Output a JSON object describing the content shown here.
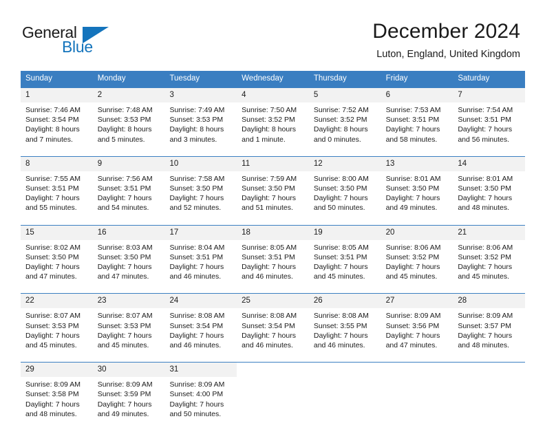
{
  "brand": {
    "name_top": "General",
    "name_bottom": "Blue",
    "accent_color": "#1474bc",
    "triangle_icon": "triangle-icon"
  },
  "header": {
    "title": "December 2024",
    "subtitle": "Luton, England, United Kingdom"
  },
  "calendar": {
    "header_bg": "#3a7ec1",
    "daynum_bg": "#f2f2f2",
    "weekdays": [
      "Sunday",
      "Monday",
      "Tuesday",
      "Wednesday",
      "Thursday",
      "Friday",
      "Saturday"
    ],
    "weeks": [
      [
        {
          "day": "1",
          "sunrise": "Sunrise: 7:46 AM",
          "sunset": "Sunset: 3:54 PM",
          "daylight1": "Daylight: 8 hours",
          "daylight2": "and 7 minutes."
        },
        {
          "day": "2",
          "sunrise": "Sunrise: 7:48 AM",
          "sunset": "Sunset: 3:53 PM",
          "daylight1": "Daylight: 8 hours",
          "daylight2": "and 5 minutes."
        },
        {
          "day": "3",
          "sunrise": "Sunrise: 7:49 AM",
          "sunset": "Sunset: 3:53 PM",
          "daylight1": "Daylight: 8 hours",
          "daylight2": "and 3 minutes."
        },
        {
          "day": "4",
          "sunrise": "Sunrise: 7:50 AM",
          "sunset": "Sunset: 3:52 PM",
          "daylight1": "Daylight: 8 hours",
          "daylight2": "and 1 minute."
        },
        {
          "day": "5",
          "sunrise": "Sunrise: 7:52 AM",
          "sunset": "Sunset: 3:52 PM",
          "daylight1": "Daylight: 8 hours",
          "daylight2": "and 0 minutes."
        },
        {
          "day": "6",
          "sunrise": "Sunrise: 7:53 AM",
          "sunset": "Sunset: 3:51 PM",
          "daylight1": "Daylight: 7 hours",
          "daylight2": "and 58 minutes."
        },
        {
          "day": "7",
          "sunrise": "Sunrise: 7:54 AM",
          "sunset": "Sunset: 3:51 PM",
          "daylight1": "Daylight: 7 hours",
          "daylight2": "and 56 minutes."
        }
      ],
      [
        {
          "day": "8",
          "sunrise": "Sunrise: 7:55 AM",
          "sunset": "Sunset: 3:51 PM",
          "daylight1": "Daylight: 7 hours",
          "daylight2": "and 55 minutes."
        },
        {
          "day": "9",
          "sunrise": "Sunrise: 7:56 AM",
          "sunset": "Sunset: 3:51 PM",
          "daylight1": "Daylight: 7 hours",
          "daylight2": "and 54 minutes."
        },
        {
          "day": "10",
          "sunrise": "Sunrise: 7:58 AM",
          "sunset": "Sunset: 3:50 PM",
          "daylight1": "Daylight: 7 hours",
          "daylight2": "and 52 minutes."
        },
        {
          "day": "11",
          "sunrise": "Sunrise: 7:59 AM",
          "sunset": "Sunset: 3:50 PM",
          "daylight1": "Daylight: 7 hours",
          "daylight2": "and 51 minutes."
        },
        {
          "day": "12",
          "sunrise": "Sunrise: 8:00 AM",
          "sunset": "Sunset: 3:50 PM",
          "daylight1": "Daylight: 7 hours",
          "daylight2": "and 50 minutes."
        },
        {
          "day": "13",
          "sunrise": "Sunrise: 8:01 AM",
          "sunset": "Sunset: 3:50 PM",
          "daylight1": "Daylight: 7 hours",
          "daylight2": "and 49 minutes."
        },
        {
          "day": "14",
          "sunrise": "Sunrise: 8:01 AM",
          "sunset": "Sunset: 3:50 PM",
          "daylight1": "Daylight: 7 hours",
          "daylight2": "and 48 minutes."
        }
      ],
      [
        {
          "day": "15",
          "sunrise": "Sunrise: 8:02 AM",
          "sunset": "Sunset: 3:50 PM",
          "daylight1": "Daylight: 7 hours",
          "daylight2": "and 47 minutes."
        },
        {
          "day": "16",
          "sunrise": "Sunrise: 8:03 AM",
          "sunset": "Sunset: 3:50 PM",
          "daylight1": "Daylight: 7 hours",
          "daylight2": "and 47 minutes."
        },
        {
          "day": "17",
          "sunrise": "Sunrise: 8:04 AM",
          "sunset": "Sunset: 3:51 PM",
          "daylight1": "Daylight: 7 hours",
          "daylight2": "and 46 minutes."
        },
        {
          "day": "18",
          "sunrise": "Sunrise: 8:05 AM",
          "sunset": "Sunset: 3:51 PM",
          "daylight1": "Daylight: 7 hours",
          "daylight2": "and 46 minutes."
        },
        {
          "day": "19",
          "sunrise": "Sunrise: 8:05 AM",
          "sunset": "Sunset: 3:51 PM",
          "daylight1": "Daylight: 7 hours",
          "daylight2": "and 45 minutes."
        },
        {
          "day": "20",
          "sunrise": "Sunrise: 8:06 AM",
          "sunset": "Sunset: 3:52 PM",
          "daylight1": "Daylight: 7 hours",
          "daylight2": "and 45 minutes."
        },
        {
          "day": "21",
          "sunrise": "Sunrise: 8:06 AM",
          "sunset": "Sunset: 3:52 PM",
          "daylight1": "Daylight: 7 hours",
          "daylight2": "and 45 minutes."
        }
      ],
      [
        {
          "day": "22",
          "sunrise": "Sunrise: 8:07 AM",
          "sunset": "Sunset: 3:53 PM",
          "daylight1": "Daylight: 7 hours",
          "daylight2": "and 45 minutes."
        },
        {
          "day": "23",
          "sunrise": "Sunrise: 8:07 AM",
          "sunset": "Sunset: 3:53 PM",
          "daylight1": "Daylight: 7 hours",
          "daylight2": "and 45 minutes."
        },
        {
          "day": "24",
          "sunrise": "Sunrise: 8:08 AM",
          "sunset": "Sunset: 3:54 PM",
          "daylight1": "Daylight: 7 hours",
          "daylight2": "and 46 minutes."
        },
        {
          "day": "25",
          "sunrise": "Sunrise: 8:08 AM",
          "sunset": "Sunset: 3:54 PM",
          "daylight1": "Daylight: 7 hours",
          "daylight2": "and 46 minutes."
        },
        {
          "day": "26",
          "sunrise": "Sunrise: 8:08 AM",
          "sunset": "Sunset: 3:55 PM",
          "daylight1": "Daylight: 7 hours",
          "daylight2": "and 46 minutes."
        },
        {
          "day": "27",
          "sunrise": "Sunrise: 8:09 AM",
          "sunset": "Sunset: 3:56 PM",
          "daylight1": "Daylight: 7 hours",
          "daylight2": "and 47 minutes."
        },
        {
          "day": "28",
          "sunrise": "Sunrise: 8:09 AM",
          "sunset": "Sunset: 3:57 PM",
          "daylight1": "Daylight: 7 hours",
          "daylight2": "and 48 minutes."
        }
      ],
      [
        {
          "day": "29",
          "sunrise": "Sunrise: 8:09 AM",
          "sunset": "Sunset: 3:58 PM",
          "daylight1": "Daylight: 7 hours",
          "daylight2": "and 48 minutes."
        },
        {
          "day": "30",
          "sunrise": "Sunrise: 8:09 AM",
          "sunset": "Sunset: 3:59 PM",
          "daylight1": "Daylight: 7 hours",
          "daylight2": "and 49 minutes."
        },
        {
          "day": "31",
          "sunrise": "Sunrise: 8:09 AM",
          "sunset": "Sunset: 4:00 PM",
          "daylight1": "Daylight: 7 hours",
          "daylight2": "and 50 minutes."
        },
        {
          "day": "",
          "sunrise": "",
          "sunset": "",
          "daylight1": "",
          "daylight2": ""
        },
        {
          "day": "",
          "sunrise": "",
          "sunset": "",
          "daylight1": "",
          "daylight2": ""
        },
        {
          "day": "",
          "sunrise": "",
          "sunset": "",
          "daylight1": "",
          "daylight2": ""
        },
        {
          "day": "",
          "sunrise": "",
          "sunset": "",
          "daylight1": "",
          "daylight2": ""
        }
      ]
    ]
  }
}
